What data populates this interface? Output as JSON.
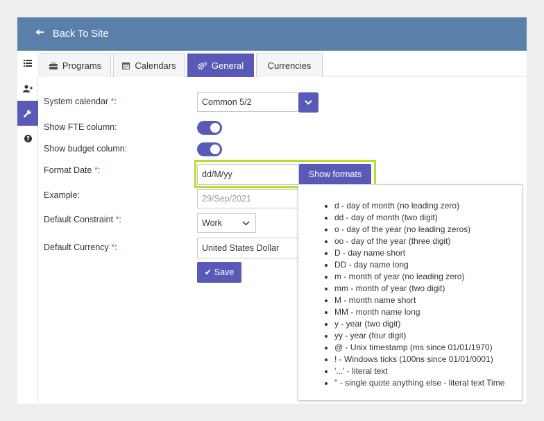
{
  "topbar": {
    "back_label": "Back To Site"
  },
  "sidebar": {
    "items": [
      {
        "icon": "list-icon",
        "active": false
      },
      {
        "icon": "user-plus-icon",
        "active": false
      },
      {
        "icon": "wrench-icon",
        "active": true
      },
      {
        "icon": "question-circle-icon",
        "active": false
      }
    ]
  },
  "tabs": [
    {
      "label": "Programs",
      "icon": "briefcase-icon",
      "active": false
    },
    {
      "label": "Calendars",
      "icon": "calendar-icon",
      "active": false
    },
    {
      "label": "General",
      "icon": "cogs-icon",
      "active": true
    },
    {
      "label": "Currencies",
      "icon": "",
      "active": false
    }
  ],
  "form": {
    "system_calendar": {
      "label": "System calendar",
      "req": "*",
      "colon": ":",
      "value": "Common 5/2"
    },
    "show_fte": {
      "label": "Show FTE column:",
      "on": true
    },
    "show_budget": {
      "label": "Show budget column:",
      "on": true
    },
    "format_date": {
      "label": "Format Date",
      "req": "*",
      "colon": ":",
      "value": "dd/M/yy",
      "button": "Show formats"
    },
    "example": {
      "label": "Example:",
      "value": "29/Sep/2021"
    },
    "default_constraint": {
      "label": "Default Constraint",
      "req": "*",
      "colon": ":",
      "value": "Work"
    },
    "default_currency": {
      "label": "Default Currency",
      "req": "*",
      "colon": ":",
      "value": "United States Dollar"
    },
    "save_label": "Save"
  },
  "formats": [
    "d - day of month (no leading zero)",
    "dd - day of month (two digit)",
    "o - day of the year (no leading zeros)",
    "oo - day of the year (three digit)",
    "D - day name short",
    "DD - day name long",
    "m - month of year (no leading zero)",
    "mm - month of year (two digit)",
    "M - month name short",
    "MM - month name long",
    "y - year (two digit)",
    "yy - year (four digit)",
    "@ - Unix timestamp (ms since 01/01/1970)",
    "! - Windows ticks (100ns since 01/01/0001)",
    "'...' - literal text",
    "'' - single quote anything else - literal text Time"
  ],
  "colors": {
    "accent": "#5959b8",
    "topbar": "#5a7fa8",
    "highlight": "#b7dd32",
    "required": "#d9534f"
  }
}
